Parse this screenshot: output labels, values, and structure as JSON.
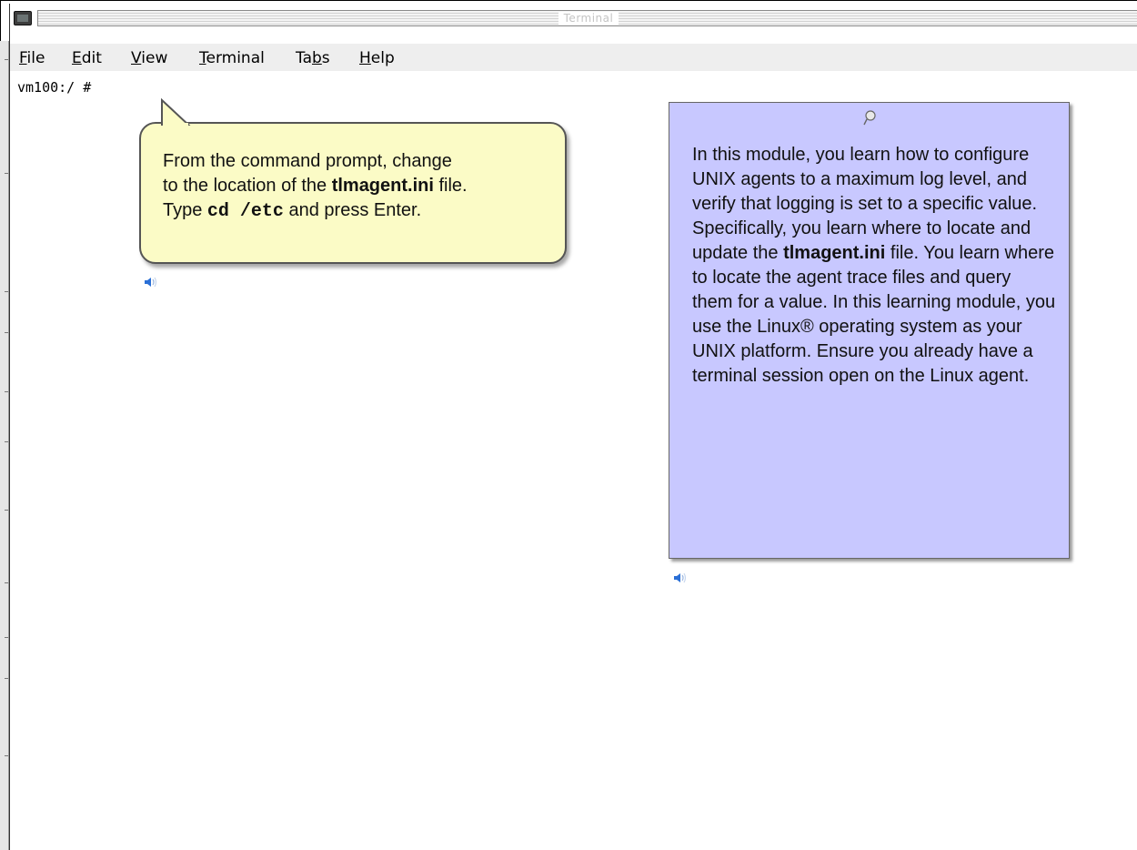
{
  "window": {
    "title": "Terminal"
  },
  "menubar": {
    "items": [
      {
        "mnemonic": "F",
        "rest": "ile"
      },
      {
        "mnemonic": "E",
        "rest": "dit"
      },
      {
        "mnemonic": "V",
        "rest": "iew"
      },
      {
        "mnemonic": "T",
        "rest": "erminal"
      },
      {
        "pre": "Ta",
        "mnemonic": "b",
        "rest": "s"
      },
      {
        "mnemonic": "H",
        "rest": "elp"
      }
    ]
  },
  "terminal": {
    "prompt": "vm100:/ #"
  },
  "callout": {
    "line1": "From the command  prompt, change",
    "line2_pre": "to the location of the ",
    "line2_bold": "tlmagent.ini",
    "line2_post": " file.",
    "line3_pre": "Type ",
    "line3_code": "cd /etc",
    "line3_post": " and press Enter."
  },
  "info_box": {
    "part1": "In this module, you learn how to configure UNIX agents to a maximum log level, and verify that logging is set to a specific value. Specifically, you learn where to locate and update the ",
    "bold": "tlmagent.ini",
    "part2": " file. You learn where to locate the agent trace files and query them for a value. In this learning  module, you use the Linux® operating system as your UNIX platform. Ensure you already have a terminal session open on the Linux agent."
  },
  "icons": {
    "speaker": "speaker-icon",
    "pin": "pushpin-icon",
    "terminal": "terminal-app-icon"
  },
  "colors": {
    "callout_bg": "#fbfbc6",
    "info_bg": "#c8c8ff",
    "menubar_bg": "#eeeeee"
  }
}
